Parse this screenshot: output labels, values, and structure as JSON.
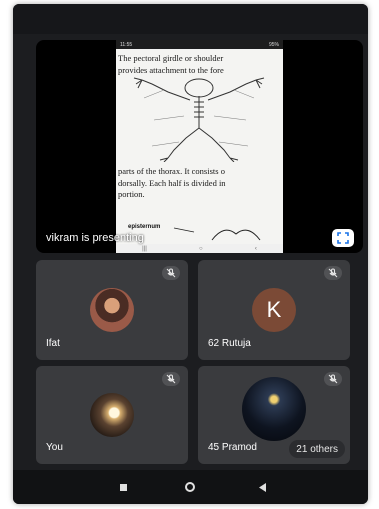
{
  "presentation": {
    "phone_status": {
      "time": "11:55",
      "right": "95%"
    },
    "book_top_lines": [
      "The pectoral girdle or shoulder",
      "provides attachment to the fore"
    ],
    "book_mid_lines": [
      "parts of the thorax. It consists o",
      "dorsally. Each half is divided in",
      "portion."
    ],
    "sternum_label": "episternum",
    "presenter_label": "vikram is presenting",
    "fullscreen_icon": "fullscreen-icon"
  },
  "tiles": [
    {
      "name": "Ifat",
      "muted": true
    },
    {
      "name": "62 Rutuja",
      "avatar_letter": "K",
      "muted": true
    },
    {
      "name": "You",
      "muted": true
    },
    {
      "name": "45 Pramod",
      "muted": true,
      "others": "21 others"
    }
  ],
  "colors": {
    "background": "#1c1d20",
    "tile": "#3a3b3e",
    "letter_avatar": "#7b4a36"
  },
  "navbar": {
    "icons": [
      "recent-apps-icon",
      "home-icon",
      "back-icon"
    ]
  }
}
